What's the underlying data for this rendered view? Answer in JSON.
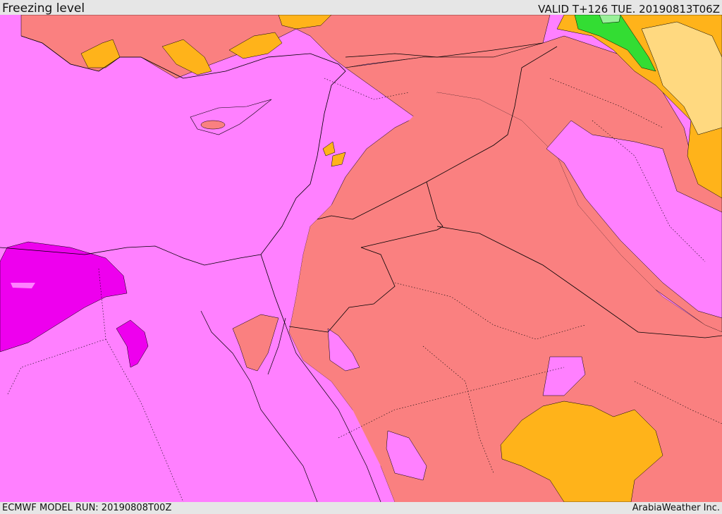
{
  "header": {
    "title": "Freezing level",
    "valid": "VALID T+126 TUE. 20190813T06Z"
  },
  "footer": {
    "model_run": "ECMWF MODEL RUN: 20190808T00Z",
    "credit": "ArabiaWeather Inc."
  },
  "colors": {
    "base": "#FF80FF",
    "salmon": "#FA8080",
    "orange": "#FFB31A",
    "light_yellow": "#FFD980",
    "green": "#33DD33",
    "light_green": "#99F099",
    "magenta": "#EE00EE"
  }
}
